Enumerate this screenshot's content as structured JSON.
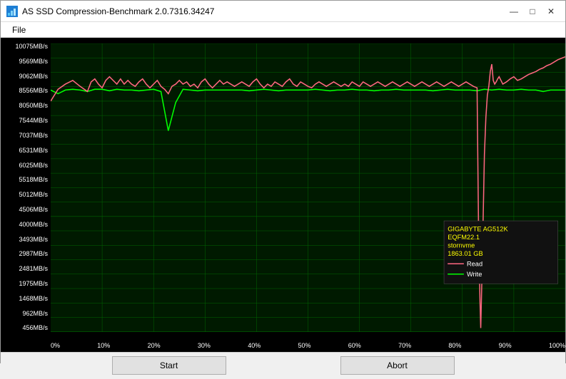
{
  "window": {
    "title": "AS SSD Compression-Benchmark 2.0.7316.34247",
    "icon": "📊"
  },
  "menu": {
    "items": [
      "File"
    ]
  },
  "yAxis": {
    "labels": [
      "10075MB/s",
      "9569MB/s",
      "9062MB/s",
      "8556MB/s",
      "8050MB/s",
      "7544MB/s",
      "7037MB/s",
      "6531MB/s",
      "6025MB/s",
      "5518MB/s",
      "5012MB/s",
      "4506MB/s",
      "4000MB/s",
      "3493MB/s",
      "2987MB/s",
      "2481MB/s",
      "1975MB/s",
      "1468MB/s",
      "962MB/s",
      "456MB/s"
    ]
  },
  "xAxis": {
    "labels": [
      "0%",
      "10%",
      "20%",
      "30%",
      "40%",
      "50%",
      "60%",
      "70%",
      "80%",
      "90%",
      "100%"
    ]
  },
  "legend": {
    "device": "GIGABYTE AG512K",
    "driver": "EQFM22.1",
    "type": "stornvme",
    "size": "1863.01 GB",
    "read_label": "Read",
    "write_label": "Write"
  },
  "buttons": {
    "start": "Start",
    "abort": "Abort"
  },
  "titleControls": {
    "minimize": "—",
    "maximize": "□",
    "close": "✕"
  }
}
